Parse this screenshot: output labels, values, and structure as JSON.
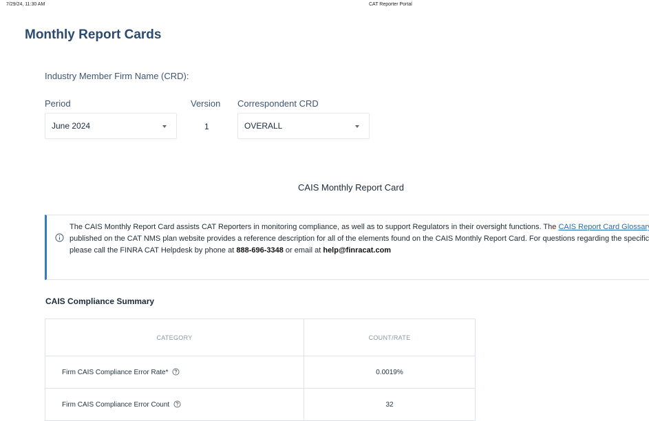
{
  "print_header": {
    "date": "7/29/24, 11:30 AM",
    "title": "CAT Reporter Portal"
  },
  "page": {
    "title": "Monthly Report Cards"
  },
  "filters": {
    "firm_label": "Industry Member Firm Name (CRD):",
    "period_label": "Period",
    "period_value": "June 2024",
    "version_label": "Version",
    "version_value": "1",
    "correspondent_label": "Correspondent CRD",
    "correspondent_value": "OVERALL"
  },
  "report": {
    "heading": "CAIS Monthly Report Card",
    "info_icon": "info-circle-icon",
    "info_text_1": "The CAIS Monthly Report Card assists CAT Reporters in monitoring compliance, as well as to support Regulators in their oversight functions. The",
    "info_link": "CAIS Report Card Glossary",
    "info_text_2": "published on the CAT NMS plan website provides a reference description for all of the elements found on the CAIS Monthly Report Card. For questions regarding the specific report, please call the FINRA CAT Helpdesk by phone at",
    "phone": "888-696-3348",
    "info_text_3": "or email at",
    "email": "help@finracat.com",
    "accent_color": "#2f7cc8"
  },
  "summary": {
    "title": "CAIS Compliance Summary",
    "columns": [
      "CATEGORY",
      "COUNT/RATE"
    ],
    "rows": [
      {
        "category": "Firm CAIS Compliance Error Rate*",
        "value": "0.0019%",
        "help_icon": "question-circle-icon"
      },
      {
        "category": "Firm CAIS Compliance Error Count",
        "value": "32",
        "help_icon": "question-circle-icon"
      }
    ]
  }
}
